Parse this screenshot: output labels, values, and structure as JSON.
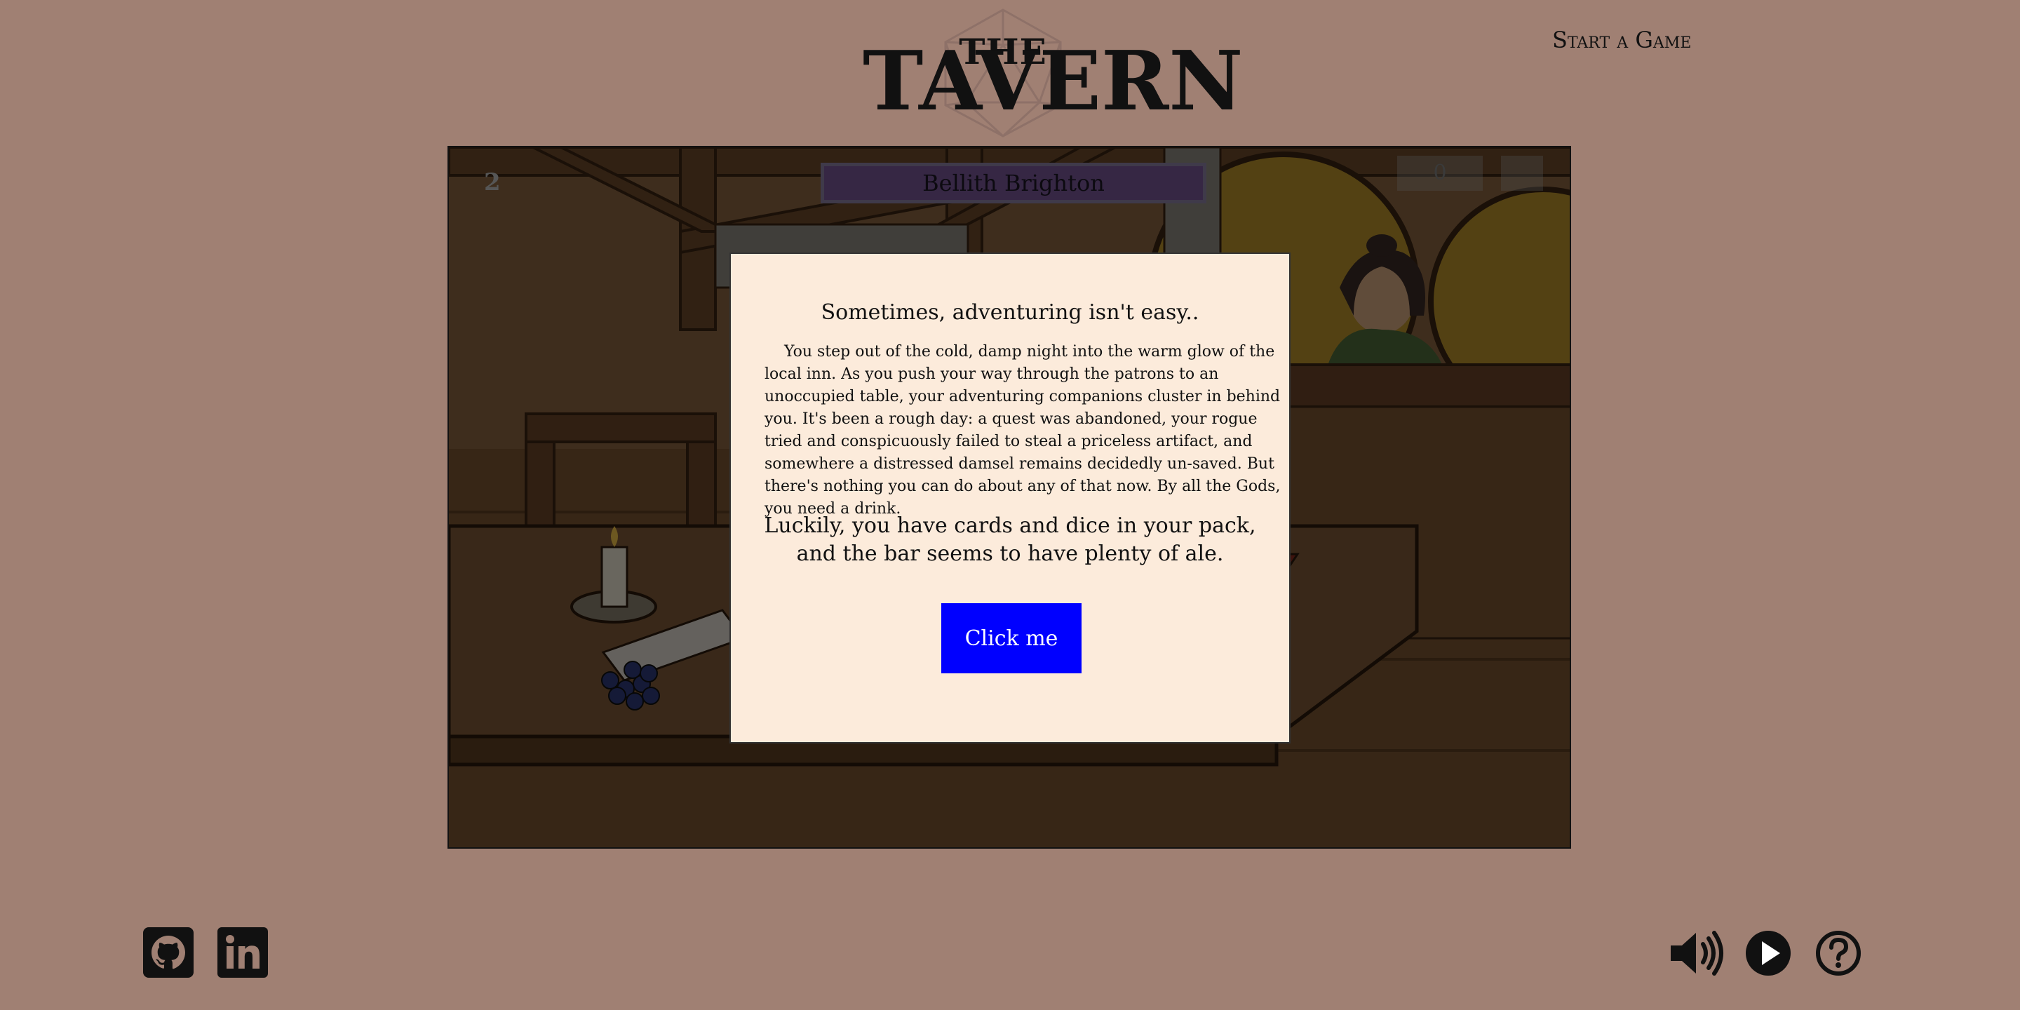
{
  "header": {
    "logo_line1": "THE",
    "logo_line2": "TAVERN",
    "nav_start_label": "Start a Game"
  },
  "scene": {
    "turn_number": "2",
    "player_name": "Bellith Brighton",
    "score": "0"
  },
  "modal": {
    "title": "Sometimes, adventuring isn't easy..",
    "body": "You step out of the cold, damp night into the warm glow of the local inn. As you push your way through the patrons to an unoccupied table, your adventuring companions cluster in behind you. It's been a rough day: a quest was abandoned, your rogue tried and conspicuously failed to steal a priceless artifact, and somewhere a distressed damsel remains decidedly un-saved. But there's nothing you can do about any of that now. By all the Gods, you need a drink.",
    "lead_line1": "Luckily, you have cards and dice in your pack,",
    "lead_line2": "and the bar seems to have plenty of ale.",
    "button_label": "Click me",
    "button_color": "#0000ff"
  },
  "footer": {
    "left_icons": [
      "github-icon",
      "linkedin-icon"
    ],
    "right_icons": [
      "volume-icon",
      "play-icon",
      "help-icon"
    ]
  },
  "colors": {
    "page_background": "#a08073",
    "modal_background": "#fcebdb"
  }
}
